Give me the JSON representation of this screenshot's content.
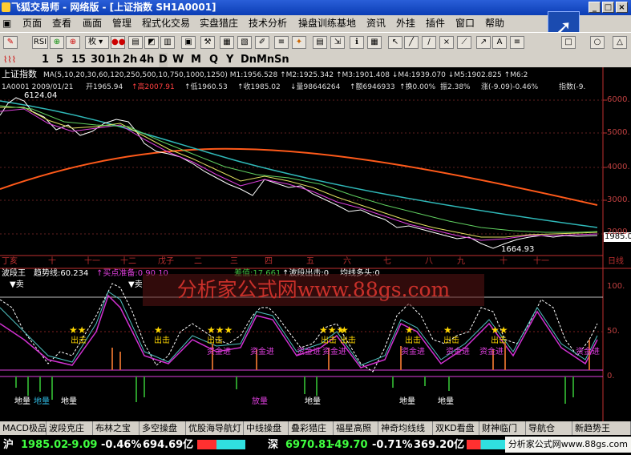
{
  "window": {
    "title": "飞狐交易师 - 网络版 - [上证指数 SH1A0001]"
  },
  "menu": [
    "页面",
    "查看",
    "画面",
    "管理",
    "程式化交易",
    "实盘猎庄",
    "技术分析",
    "操盘训练基地",
    "资讯",
    "外挂",
    "插件",
    "窗口",
    "帮助"
  ],
  "toolbar": {
    "period_select": "枚",
    "items": [
      "RSI",
      "tick-icon",
      "plus-icon",
      "grid-icon",
      "folder-icon",
      "chart-icon",
      "k-icon",
      "pen-icon",
      "note-icon",
      "box-icon",
      "tools-icon",
      "cursor-icon",
      "line-icon",
      "pin-icon",
      "star-icon",
      "arrow-icon",
      "menu-icon",
      "oval-icon",
      "triangle-icon"
    ]
  },
  "periods": [
    "1",
    "5",
    "15",
    "30",
    "1h",
    "2h",
    "4h",
    "D",
    "W",
    "M",
    "Q",
    "Y",
    "Dn",
    "Mn",
    "Sn"
  ],
  "main_chart": {
    "title": "上证指数",
    "ma_line": "MA(5,10,20,30,60,120,250,500,10,750,1000,1250) M1:1956.528 ↑M2:1925.342 ↑M3:1901.408 ↓M4:1939.070 ↓M5:1902.825 ↑M6:2",
    "info_code": "1A0001 2009/01/21",
    "info_open": "开1965.94",
    "info_high": "↑高2007.91",
    "info_low": "↑低1960.53",
    "info_close": "↑收1985.02",
    "info_vol": "↓量98646264",
    "info_amt": "↑额6946933",
    "info_turn": "↑换0.00%",
    "info_amp": "振2.38%",
    "info_chg": "涨(-9.09)-0.46%",
    "info_idx": "指数(-9.",
    "price_high_label": "6124.04",
    "price_low_label": "1664.93",
    "current_price_tag": "1985.0",
    "price_ticks": [
      "6000.",
      "5000.",
      "4000.",
      "3000.",
      "2000."
    ],
    "months": [
      "丁亥",
      "十",
      "十一",
      "十二",
      "戊子",
      "二",
      "三",
      "四",
      "五",
      "六",
      "七",
      "八",
      "九",
      "十",
      "十一",
      "日线"
    ]
  },
  "indicator": {
    "name": "波段王",
    "trend": "趋势线:60.234",
    "buy_ready": "↑买点准备:0 90 10",
    "diff": "差值:17.661",
    "band_exit": "↑波段出击:0",
    "ma_bull": "均线多头:0",
    "sell_labels": [
      "▼卖",
      "▼卖"
    ],
    "ticks": [
      "100.",
      "50.",
      "0."
    ],
    "labels_chuji": "出击",
    "labels_jinjin": "资金进",
    "labels_diliang": "地量",
    "labels_fangliang": "放量"
  },
  "watermark": "分析家公式网www.88gs.com",
  "tabs": [
    "MACD极品",
    "波段克庄",
    "布林之宝",
    "多空操盘",
    "优股海导航灯",
    "中线操盘",
    "叠彩猎庄",
    "福星高照",
    "神奇均线线",
    "双KD看盘",
    "财神临门",
    "导航仓",
    "新趋势王"
  ],
  "status": {
    "sh_label": "沪",
    "sh_val": "1985.02",
    "sh_chg": "-9.09",
    "sh_pct": "-0.46%",
    "sh_amt": "694.69亿",
    "sz_label": "深",
    "sz_val": "6970.81",
    "sz_chg": "-49.70",
    "sz_pct": "-0.71%",
    "sz_amt": "369.20亿",
    "site": "分析家公式网www.88gs.com"
  }
}
